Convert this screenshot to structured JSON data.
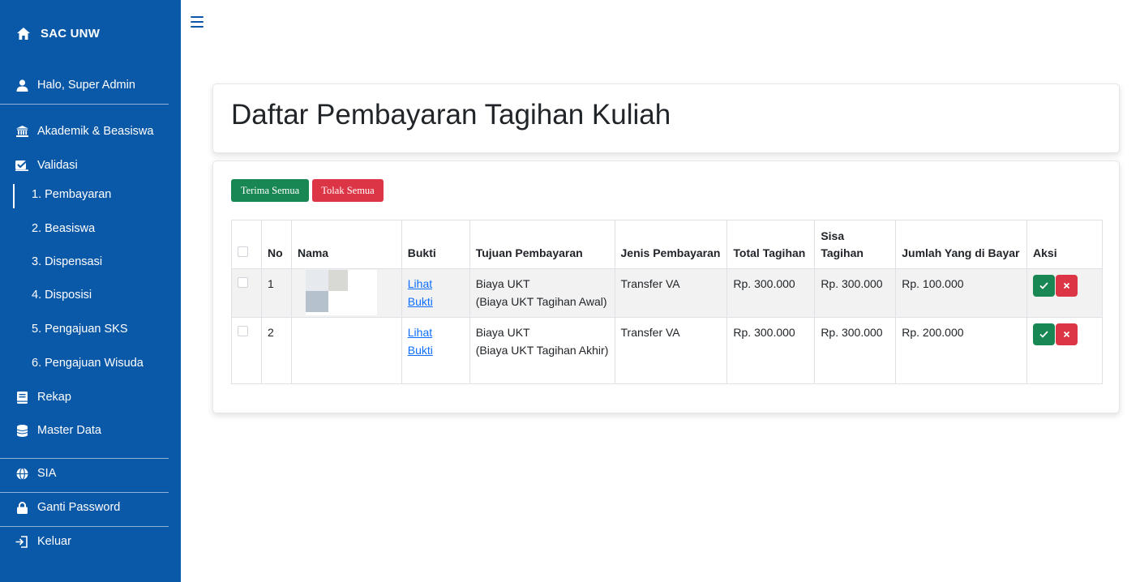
{
  "sidebar": {
    "brand": "SAC UNW",
    "user_greeting": "Halo, Super Admin",
    "menu": {
      "akademik": "Akademik & Beasiswa",
      "validasi": "Validasi",
      "sub": [
        "1. Pembayaran",
        "2. Beasiswa",
        "3. Dispensasi",
        "4. Disposisi",
        "5. Pengajuan SKS",
        "6. Pengajuan Wisuda"
      ],
      "rekap": "Rekap",
      "master_data": "Master Data",
      "sia": "SIA",
      "ganti_password": "Ganti Password",
      "keluar": "Keluar"
    }
  },
  "page": {
    "title": "Daftar Pembayaran Tagihan Kuliah",
    "accept_all": "Terima Semua",
    "reject_all": "Tolak Semua"
  },
  "table": {
    "headers": {
      "no": "No",
      "nama": "Nama",
      "bukti": "Bukti",
      "tujuan": "Tujuan Pembayaran",
      "jenis": "Jenis Pembayaran",
      "total": "Total Tagihan",
      "sisa": "Sisa Tagihan",
      "jumlah": "Jumlah Yang di Bayar",
      "aksi": "Aksi"
    },
    "rows": [
      {
        "no": "1",
        "nama": "",
        "bukti_1": "Lihat",
        "bukti_2": "Bukti",
        "tujuan_1": "Biaya UKT",
        "tujuan_2": "(Biaya UKT Tagihan Awal)",
        "jenis": "Transfer VA",
        "total": "Rp. 300.000",
        "sisa": "Rp. 300.000",
        "jumlah": "Rp. 100.000"
      },
      {
        "no": "2",
        "nama": "",
        "bukti_1": "Lihat",
        "bukti_2": "Bukti",
        "tujuan_1": "Biaya UKT",
        "tujuan_2": "(Biaya UKT Tagihan Akhir)",
        "jenis": "Transfer VA",
        "total": "Rp. 300.000",
        "sisa": "Rp. 300.000",
        "jumlah": "Rp. 200.000"
      }
    ]
  },
  "colors": {
    "sidebar": "#0a58a8",
    "success": "#198754",
    "danger": "#dc3545",
    "link": "#0d6efd"
  }
}
